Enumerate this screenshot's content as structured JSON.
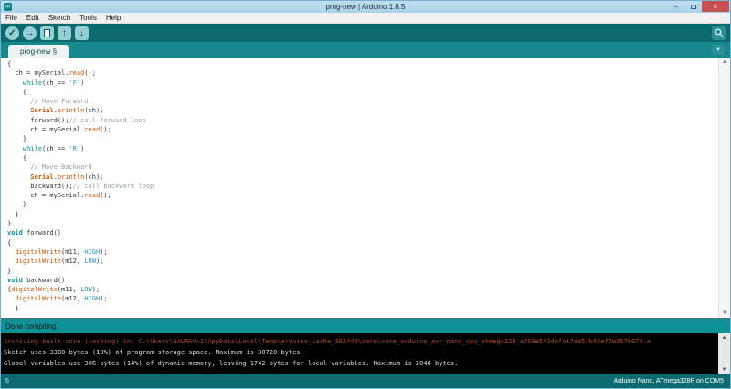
{
  "window": {
    "title": "prog-new | Arduino 1.8.5",
    "controls": {
      "minimize": "–",
      "close": "×"
    },
    "app_icon_glyph": "∞"
  },
  "menu": {
    "items": [
      "File",
      "Edit",
      "Sketch",
      "Tools",
      "Help"
    ]
  },
  "icons": {
    "verify": "✓",
    "upload": "→",
    "open": "↑",
    "save": "↓",
    "dropdown": "▼",
    "scroll_up": "▲",
    "scroll_down": "▼"
  },
  "tabs": {
    "active": "prog-new §"
  },
  "editor": {
    "lines": [
      [
        [
          "p",
          "{"
        ]
      ],
      [
        [
          "p",
          "  ch = mySerial."
        ],
        [
          "f",
          "read"
        ],
        [
          "p",
          "();"
        ]
      ],
      [
        [
          "p",
          "    "
        ],
        [
          "k",
          "while"
        ],
        [
          "p",
          "(ch == "
        ],
        [
          "s",
          "'F'"
        ],
        [
          "p",
          ")"
        ]
      ],
      [
        [
          "p",
          "    {"
        ]
      ],
      [
        [
          "c",
          "      // Move Forward"
        ]
      ],
      [
        [
          "p",
          "      "
        ],
        [
          "F",
          "Serial"
        ],
        [
          "p",
          "."
        ],
        [
          "f",
          "println"
        ],
        [
          "p",
          "(ch);"
        ]
      ],
      [
        [
          "p",
          "      forward();"
        ],
        [
          "c",
          "// call forward loop"
        ]
      ],
      [
        [
          "p",
          "      ch = mySerial."
        ],
        [
          "f",
          "read"
        ],
        [
          "p",
          "();"
        ]
      ],
      [
        [
          "p",
          "    }"
        ]
      ],
      [
        [
          "p",
          "    "
        ],
        [
          "k",
          "while"
        ],
        [
          "p",
          "(ch == "
        ],
        [
          "s",
          "'R'"
        ],
        [
          "p",
          ")"
        ]
      ],
      [
        [
          "p",
          "    {"
        ]
      ],
      [
        [
          "c",
          "      // Move Backward"
        ]
      ],
      [
        [
          "p",
          "      "
        ],
        [
          "F",
          "Serial"
        ],
        [
          "p",
          "."
        ],
        [
          "f",
          "println"
        ],
        [
          "p",
          "(ch);"
        ]
      ],
      [
        [
          "p",
          "      backward();"
        ],
        [
          "c",
          "// call backward loop"
        ]
      ],
      [
        [
          "p",
          "      ch = mySerial."
        ],
        [
          "f",
          "read"
        ],
        [
          "p",
          "();"
        ]
      ],
      [
        [
          "p",
          "    }"
        ]
      ],
      [
        [
          "p",
          "  }"
        ]
      ],
      [
        [
          "p",
          "}"
        ]
      ],
      [
        [
          "v",
          "void"
        ],
        [
          "p",
          " forward()"
        ]
      ],
      [
        [
          "p",
          "{"
        ]
      ],
      [
        [
          "p",
          "  "
        ],
        [
          "f",
          "digitalWrite"
        ],
        [
          "p",
          "(m11, "
        ],
        [
          "l",
          "HIGH"
        ],
        [
          "p",
          ");"
        ]
      ],
      [
        [
          "p",
          "  "
        ],
        [
          "f",
          "digitalWrite"
        ],
        [
          "p",
          "(m12, "
        ],
        [
          "l",
          "LOW"
        ],
        [
          "p",
          ");"
        ]
      ],
      [
        [
          "p",
          "}"
        ]
      ],
      [
        [
          "v",
          "void"
        ],
        [
          "p",
          " backward()"
        ]
      ],
      [
        [
          "p",
          "{"
        ],
        [
          "f",
          "digitalWrite"
        ],
        [
          "p",
          "(m11, "
        ],
        [
          "l",
          "LOW"
        ],
        [
          "p",
          ");"
        ]
      ],
      [
        [
          "p",
          "  "
        ],
        [
          "f",
          "digitalWrite"
        ],
        [
          "p",
          "(m12, "
        ],
        [
          "l",
          "HIGH"
        ],
        [
          "p",
          ");"
        ]
      ],
      [
        [
          "p",
          "  }"
        ]
      ]
    ]
  },
  "status_bar": {
    "message": "Done compiling."
  },
  "console": {
    "lines": [
      {
        "color": "orange",
        "text": "Archiving built core (caching) in: C:\\Users\\GAURAV~1\\AppData\\Local\\Temp\\arduino_cache_392444\\core\\core_arduino_avr_nano_cpu_atmega328_a769e5f3defa17de54b43ef7e3579674.a"
      },
      {
        "color": "white",
        "text": "Sketch uses 3300 bytes (10%) of program storage space. Maximum is 30720 bytes."
      },
      {
        "color": "white",
        "text": "Global variables use 306 bytes (14%) of dynamic memory, leaving 1742 bytes for local variables. Maximum is 2048 bytes."
      }
    ]
  },
  "footer": {
    "line_number": "6",
    "board_info": "Arduino Nano, ATmega328P on COM5"
  },
  "colors": {
    "toolbar_teal": "#0c696e",
    "tabbar_teal": "#17898e",
    "status_teal": "#0f9297",
    "footer_teal": "#0b6b70",
    "close_red": "#c75050",
    "keyword": "#00979c",
    "function_orange": "#d35400",
    "comment_gray": "#95a5a6",
    "literal_blue": "#2b95bd",
    "console_orange": "#b5491f"
  }
}
